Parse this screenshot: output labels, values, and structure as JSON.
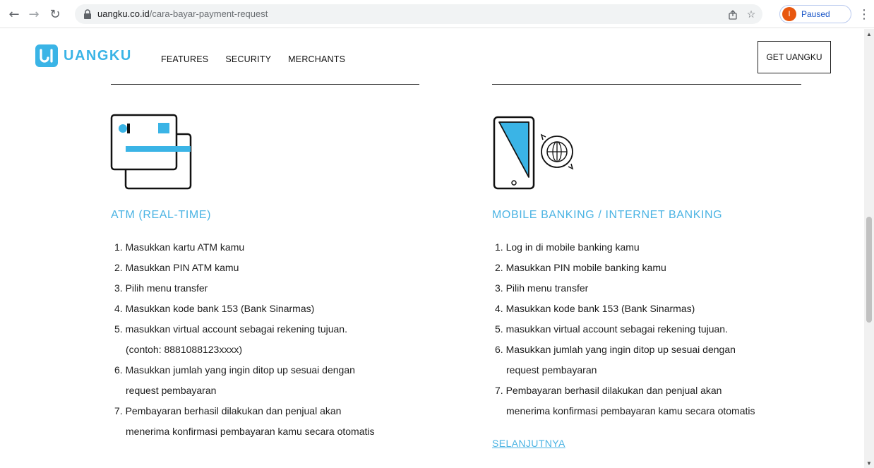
{
  "browser": {
    "url_host": "uangku.co.id",
    "url_path": "/cara-bayar-payment-request",
    "profile_initial": "I",
    "profile_status": "Paused",
    "icons": [
      "back-icon",
      "forward-icon",
      "reload-icon",
      "lock-icon",
      "share-icon",
      "star-icon",
      "menu-icon"
    ]
  },
  "header": {
    "brand": "UANGKU",
    "nav": [
      "FEATURES",
      "SECURITY",
      "MERCHANTS"
    ],
    "cta_label": "GET UANGKU"
  },
  "colors": {
    "accent": "#4ab3e3",
    "text": "#1d1d1d",
    "profile": "#e8570f"
  },
  "atm": {
    "title": "ATM (REAL-TIME)",
    "lines": [
      "1. Masukkan kartu ATM kamu",
      "2. Masukkan PIN ATM kamu",
      "3. Pilih menu transfer",
      "4. Masukkan kode bank 153 (Bank Sinarmas)",
      "5. masukkan virtual account sebagai rekening tujuan.",
      "(contoh: 8881088123xxxx)",
      "6. Masukkan jumlah yang ingin ditop up sesuai dengan",
      "request pembayaran",
      "7. Pembayaran berhasil dilakukan dan penjual akan",
      "menerima konfirmasi pembayaran kamu secara otomatis"
    ]
  },
  "mobile": {
    "title": "MOBILE BANKING / INTERNET BANKING",
    "lines": [
      "1. Log in di mobile banking kamu",
      "2. Masukkan PIN mobile banking kamu",
      "3. Pilih menu transfer",
      "4. Masukkan kode bank 153 (Bank Sinarmas)",
      "5. masukkan virtual account sebagai rekening tujuan.",
      "6. Masukkan jumlah yang ingin ditop up sesuai dengan",
      "request pembayaran",
      "7. Pembayaran berhasil dilakukan dan penjual akan",
      "menerima konfirmasi pembayaran kamu secara otomatis"
    ],
    "next_label": "SELANJUTNYA"
  }
}
